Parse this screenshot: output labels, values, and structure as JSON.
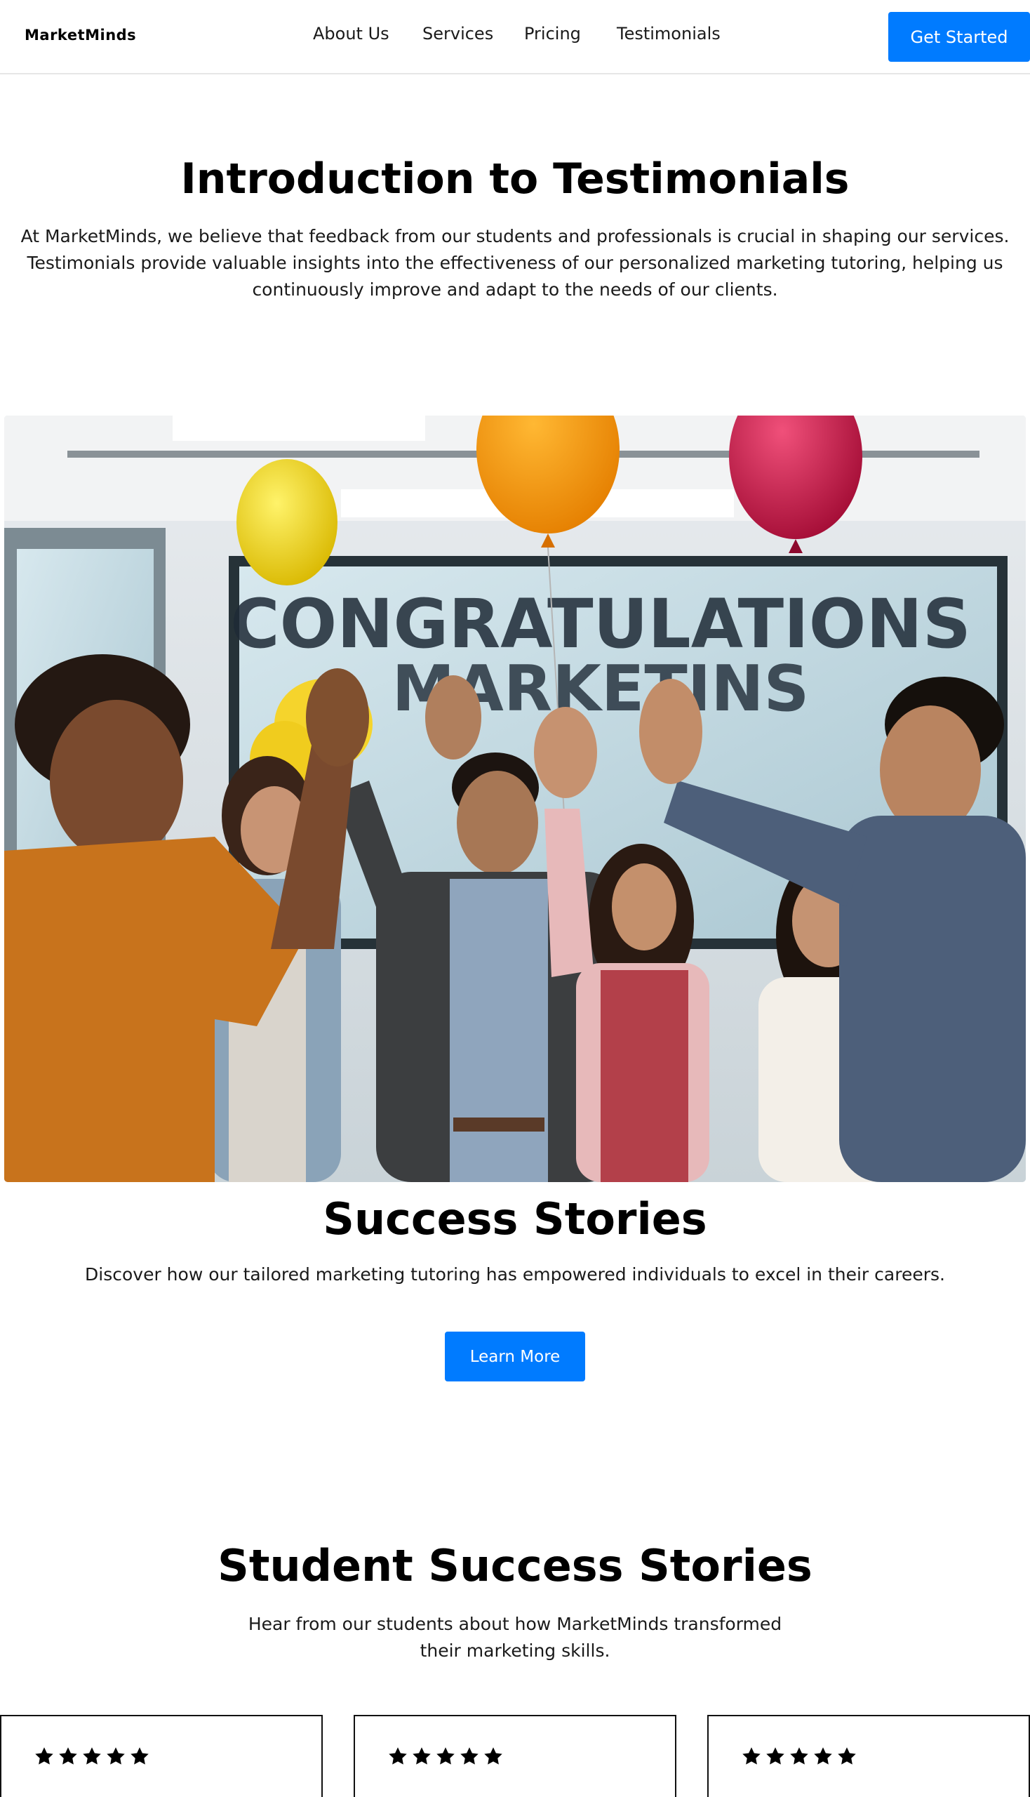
{
  "header": {
    "logo": "MarketMinds",
    "nav": [
      "About Us",
      "Services",
      "Pricing",
      "Testimonials"
    ],
    "cta": "Get Started"
  },
  "intro": {
    "title": "Introduction to Testimonials",
    "text": "At MarketMinds, we believe that feedback from our students and professionals is crucial in shaping our services. Testimonials provide valuable insights into the effectiveness of our personalized marketing tutoring, helping us continuously improve and adapt to the needs of our clients."
  },
  "hero": {
    "banner_line1": "CONGRATULATIONS",
    "banner_line2": "MARKETINS"
  },
  "success": {
    "title": "Success Stories",
    "text": "Discover how our tailored marketing tutoring has empowered individuals to excel in their careers.",
    "button": "Learn More"
  },
  "student": {
    "title": "Student Success Stories",
    "text": "Hear from our students about how MarketMinds transformed their marketing skills."
  },
  "cards": [
    {
      "rating": 5
    },
    {
      "rating": 5
    },
    {
      "rating": 5
    }
  ],
  "colors": {
    "accent": "#007bff"
  }
}
